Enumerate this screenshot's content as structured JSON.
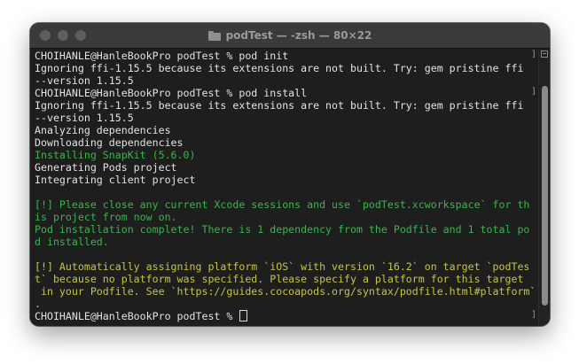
{
  "window": {
    "title": "podTest — -zsh — 80×22"
  },
  "terminal": {
    "lines": [
      {
        "text": "CHOIHANLE@HanleBookPro podTest % pod init",
        "color": "default"
      },
      {
        "text": "Ignoring ffi-1.15.5 because its extensions are not built. Try: gem pristine ffi",
        "color": "default"
      },
      {
        "text": "--version 1.15.5",
        "color": "default"
      },
      {
        "text": "CHOIHANLE@HanleBookPro podTest % pod install",
        "color": "default"
      },
      {
        "text": "Ignoring ffi-1.15.5 because its extensions are not built. Try: gem pristine ffi",
        "color": "default"
      },
      {
        "text": "--version 1.15.5",
        "color": "default"
      },
      {
        "text": "Analyzing dependencies",
        "color": "default"
      },
      {
        "text": "Downloading dependencies",
        "color": "default"
      },
      {
        "text": "Installing SnapKit (5.6.0)",
        "color": "green"
      },
      {
        "text": "Generating Pods project",
        "color": "default"
      },
      {
        "text": "Integrating client project",
        "color": "default"
      },
      {
        "text": "",
        "color": "default"
      },
      {
        "text": "[!] Please close any current Xcode sessions and use `podTest.xcworkspace` for th",
        "color": "green"
      },
      {
        "text": "is project from now on.",
        "color": "green"
      },
      {
        "text": "Pod installation complete! There is 1 dependency from the Podfile and 1 total po",
        "color": "green"
      },
      {
        "text": "d installed.",
        "color": "green"
      },
      {
        "text": "",
        "color": "default"
      },
      {
        "text": "[!] Automatically assigning platform `iOS` with version `16.2` on target `podTes",
        "color": "yellow"
      },
      {
        "text": "t` because no platform was specified. Please specify a platform for this target",
        "color": "yellow"
      },
      {
        "text": " in your Podfile. See `https://guides.cocoapods.org/syntax/podfile.html#platform`",
        "color": "yellow"
      },
      {
        "text": ".",
        "color": "yellow"
      },
      {
        "text": "CHOIHANLE@HanleBookPro podTest % ",
        "color": "default"
      }
    ]
  },
  "colors": {
    "default": "#e2e2e2",
    "green": "#37b64a",
    "yellow": "#c7c442",
    "background": "#1e1e1e"
  }
}
